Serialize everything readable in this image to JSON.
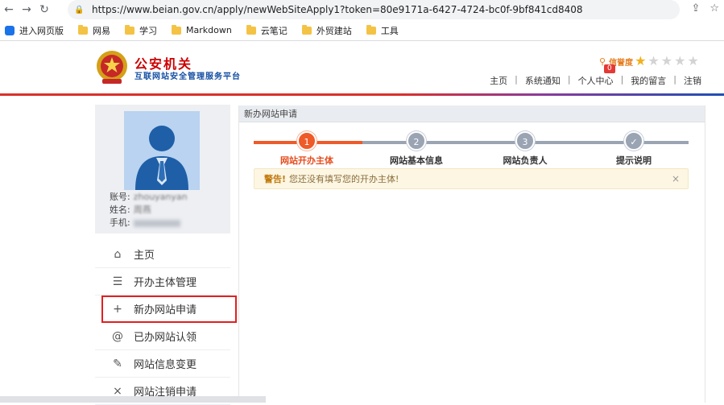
{
  "browser": {
    "url": "https://www.beian.gov.cn/apply/newWebSiteApply1?token=80e9171a-6427-4724-bc0f-9bf841cd8408"
  },
  "bookmarks": [
    {
      "label": "进入网页版",
      "icon": "app-icon"
    },
    {
      "label": "网易",
      "icon": "folder-icon"
    },
    {
      "label": "学习",
      "icon": "folder-icon"
    },
    {
      "label": "Markdown",
      "icon": "folder-icon"
    },
    {
      "label": "云笔记",
      "icon": "folder-icon"
    },
    {
      "label": "外贸建站",
      "icon": "folder-icon"
    },
    {
      "label": "工具",
      "icon": "folder-icon"
    }
  ],
  "header": {
    "brand_main": "公安机关",
    "brand_sub": "互联网站安全管理服务平台",
    "credit_label": "信誉度",
    "credit_badge": "0",
    "credit_stars": 1,
    "credit_max": 5,
    "nav": [
      "主页",
      "系统通知",
      "个人中心",
      "我的留言",
      "注销"
    ]
  },
  "profile": {
    "account_label": "账号:",
    "account_value": "zhouyanyan",
    "name_label": "姓名:",
    "name_value": "周燕",
    "phone_label": "手机:"
  },
  "menu": [
    {
      "label": "主页",
      "icon": "home-icon",
      "glyph": "⌂"
    },
    {
      "label": "开办主体管理",
      "icon": "list-icon",
      "glyph": "☰"
    },
    {
      "label": "新办网站申请",
      "icon": "plus-icon",
      "glyph": "+"
    },
    {
      "label": "已办网站认领",
      "icon": "at-icon",
      "glyph": "@"
    },
    {
      "label": "网站信息变更",
      "icon": "edit-icon",
      "glyph": "✎"
    },
    {
      "label": "网站注销申请",
      "icon": "close-icon",
      "glyph": "×"
    }
  ],
  "content": {
    "title": "新办网站申请",
    "steps": [
      {
        "num": "1",
        "label": "网站开办主体"
      },
      {
        "num": "2",
        "label": "网站基本信息"
      },
      {
        "num": "3",
        "label": "网站负责人"
      },
      {
        "num": "✓",
        "label": "提示说明"
      }
    ],
    "alert_strong": "警告!",
    "alert_text": "您还没有填写您的开办主体!",
    "alert_close": "×"
  },
  "colors": {
    "accent": "#ef5a29",
    "brand_red": "#cc0000",
    "brand_blue": "#154fa3"
  }
}
